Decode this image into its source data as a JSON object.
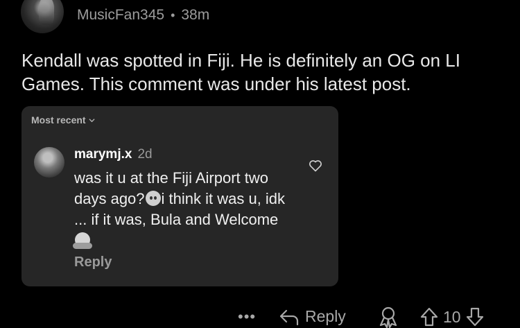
{
  "post": {
    "username": "MusicFan345",
    "separator": "•",
    "time": "38m",
    "body": "Kendall was spotted in Fiji. He is definitely an OG on LI Games. This comment was under his latest post."
  },
  "embedded": {
    "sort_label": "Most recent",
    "comment": {
      "username": "marymj.x",
      "time": "2d",
      "text_part1": "was it u at the Fiji Airport two days ago?",
      "emoji1": "no-mouth-face",
      "text_part2": "i think it was u, idk ... if it was, Bula and Welcome",
      "emoji2": "hugging-face",
      "reply_label": "Reply"
    }
  },
  "actions": {
    "more_label": "•••",
    "reply_label": "Reply",
    "vote_count": "10"
  }
}
